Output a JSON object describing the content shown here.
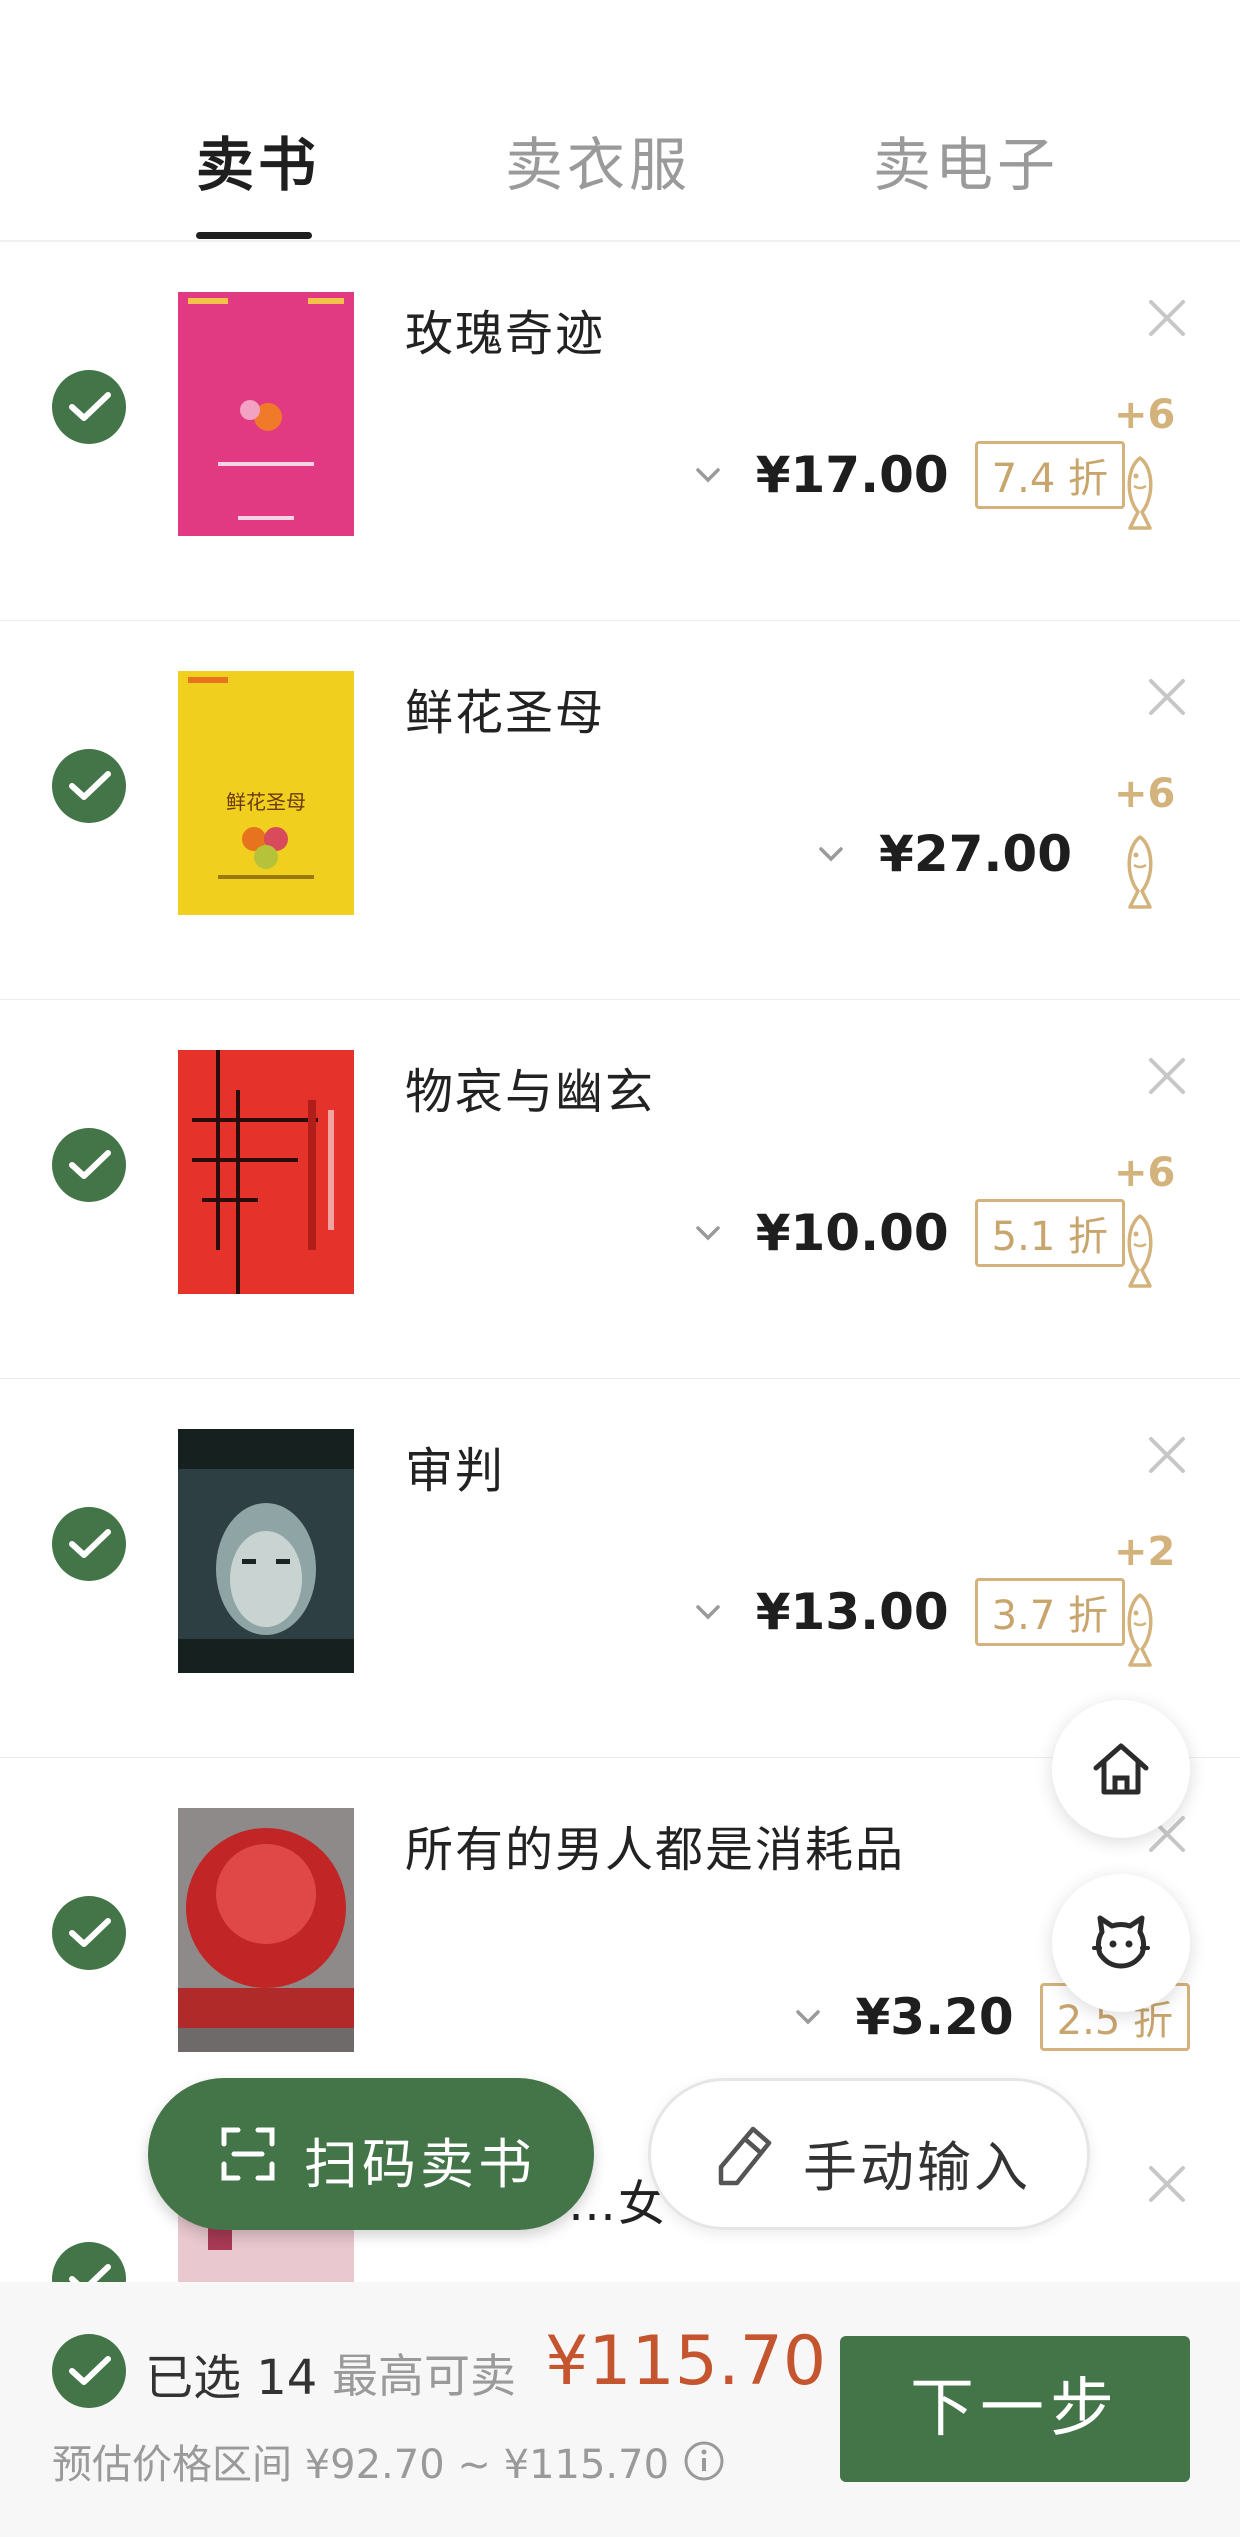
{
  "tabs": [
    {
      "label": "卖书",
      "active": true
    },
    {
      "label": "卖衣服",
      "active": false
    },
    {
      "label": "卖电子",
      "active": false
    }
  ],
  "items": [
    {
      "title": "玫瑰奇迹",
      "price": "¥17.00",
      "discount": "7.4 折",
      "fish_bonus": "+6",
      "cover_color": "#e23a82"
    },
    {
      "title": "鲜花圣母",
      "price": "¥27.00",
      "discount": "",
      "fish_bonus": "+6",
      "cover_color": "#f1cf1f",
      "cover_text": "鲜花圣母"
    },
    {
      "title": "物哀与幽玄",
      "price": "¥10.00",
      "discount": "5.1 折",
      "fish_bonus": "+6",
      "cover_color": "#e5322b"
    },
    {
      "title": "审判",
      "price": "¥13.00",
      "discount": "3.7 折",
      "fish_bonus": "+2",
      "cover_color": "#2e3f43"
    },
    {
      "title": "所有的男人都是消耗品",
      "price": "¥3.20",
      "discount": "2.5 折",
      "fish_bonus": "",
      "cover_color": "#b02a2a"
    },
    {
      "title": "…女",
      "price": "",
      "discount": "",
      "fish_bonus": "",
      "cover_color": "#e9c8cf"
    }
  ],
  "actions": {
    "scan_label": "扫码卖书",
    "manual_label": "手动输入"
  },
  "bottom": {
    "selected_label": "已选 14",
    "max_label": "最高可卖",
    "total": "¥115.70",
    "range": "预估价格区间 ¥92.70 ~ ¥115.70",
    "next_label": "下一步"
  },
  "colors": {
    "primary_green": "#437548",
    "gold": "#d3b27b",
    "price_red": "#c4552f"
  },
  "icons": [
    "check-icon",
    "close-icon",
    "chevron-down-icon",
    "fish-icon",
    "home-icon",
    "cat-icon",
    "scan-icon",
    "pen-icon",
    "info-icon"
  ]
}
